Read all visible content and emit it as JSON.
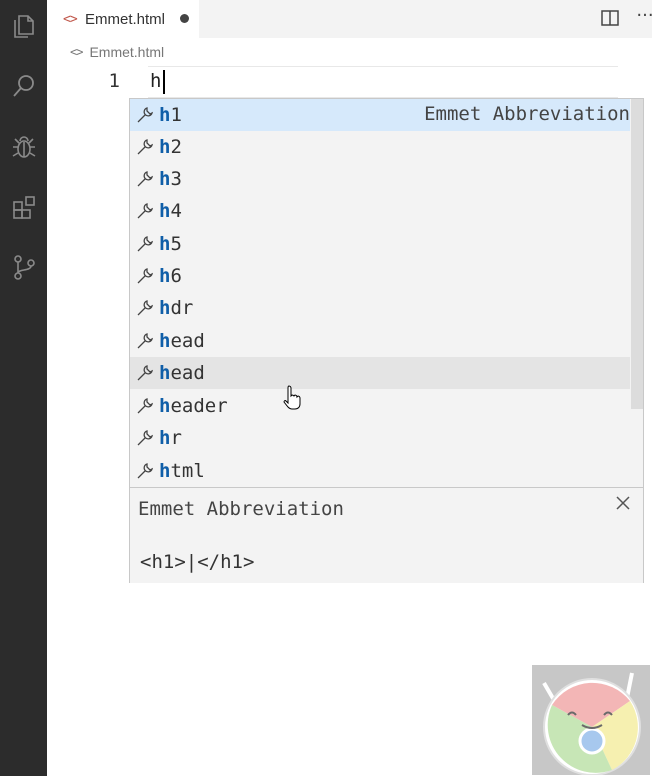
{
  "activity_bar": {
    "icons": [
      "explorer-icon",
      "search-icon",
      "debug-icon",
      "extensions-icon",
      "source-control-icon"
    ]
  },
  "tab": {
    "icon": "<>",
    "label": "Emmet.html"
  },
  "toolbar": {
    "more_label": "···"
  },
  "breadcrumb": {
    "icon": "<>",
    "label": "Emmet.html"
  },
  "editor": {
    "line_number": "1",
    "text": "h"
  },
  "suggest": {
    "match": "h",
    "items": [
      {
        "rest": "1",
        "detail": "Emmet Abbreviation"
      },
      {
        "rest": "2"
      },
      {
        "rest": "3"
      },
      {
        "rest": "4"
      },
      {
        "rest": "5"
      },
      {
        "rest": "6"
      },
      {
        "rest": "dr"
      },
      {
        "rest": "ead"
      },
      {
        "rest": "ead"
      },
      {
        "rest": "eader"
      },
      {
        "rest": "r"
      },
      {
        "rest": "tml"
      }
    ],
    "details": {
      "title": "Emmet Abbreviation",
      "body": "<h1>|</h1>"
    }
  },
  "colors": {
    "activity_bar": "#2c2c2c",
    "selected_item": "#d6e9fb",
    "match_highlight": "#0f5ea8",
    "widget_bg": "#f3f3f3"
  }
}
